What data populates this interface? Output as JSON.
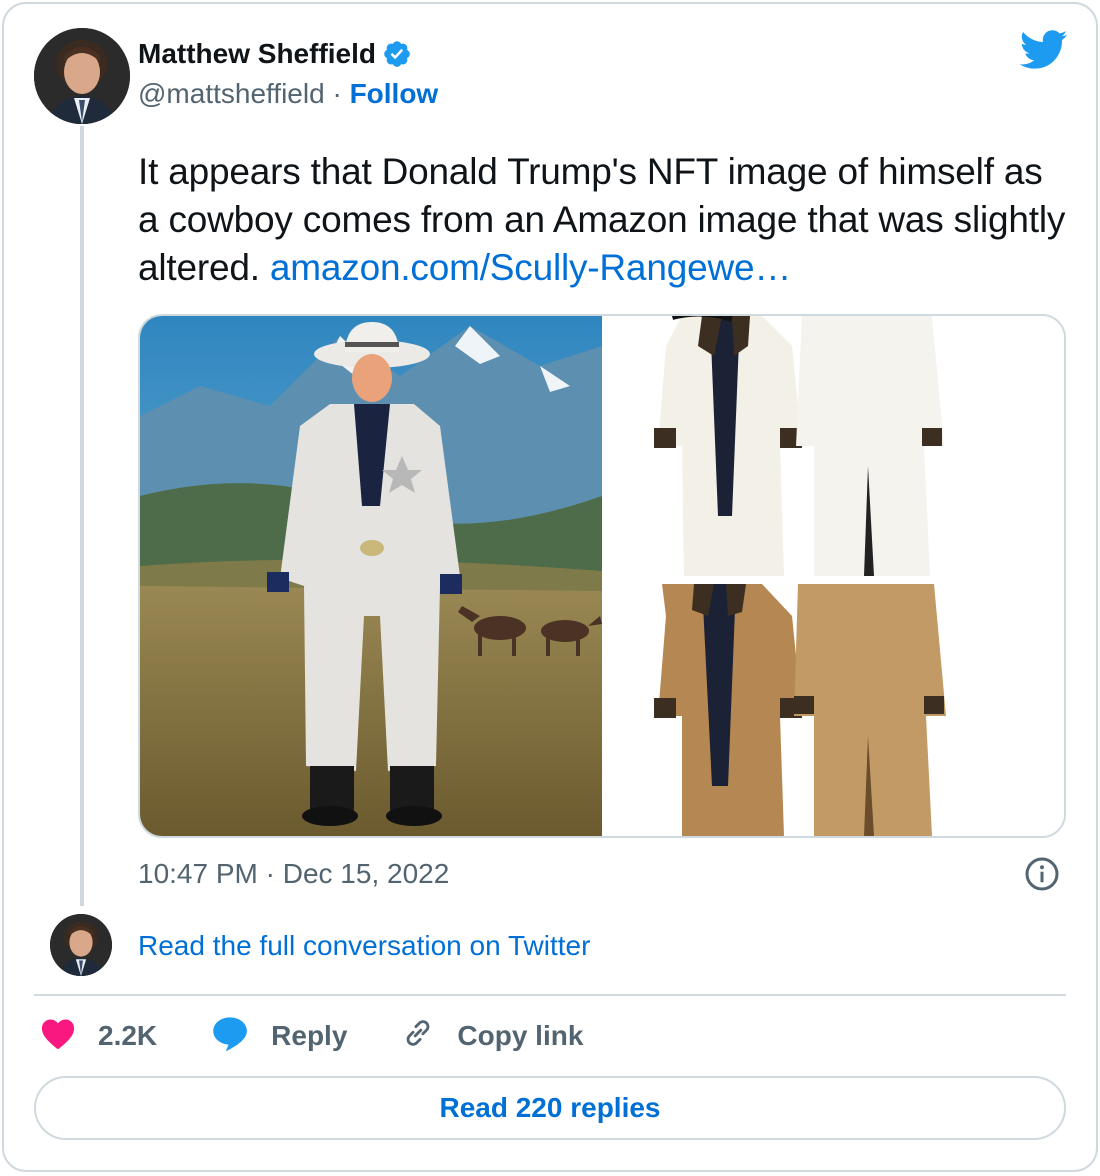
{
  "author": {
    "name": "Matthew Sheffield",
    "handle": "@mattsheffield",
    "separator": "·",
    "follow_label": "Follow",
    "verified": true
  },
  "tweet": {
    "text": "It appears that Donald Trump's NFT image of himself as a cowboy comes from an Amazon image that was slightly altered.",
    "link_text": "amazon.com/Scully-Rangewe…",
    "timestamp": "10:47 PM · Dec 15, 2022"
  },
  "conversation": {
    "read_full_label": "Read the full conversation on Twitter"
  },
  "actions": {
    "likes_count": "2.2K",
    "reply_label": "Reply",
    "copy_link_label": "Copy link"
  },
  "footer": {
    "read_replies_label": "Read 220 replies"
  },
  "icons": {
    "verified": "verified-badge-icon",
    "platform": "twitter-bird-icon",
    "info": "info-icon",
    "like": "heart-icon",
    "reply": "reply-bubble-icon",
    "copy": "link-icon"
  },
  "colors": {
    "link": "#006fd6",
    "twitter_blue": "#1d9bf0",
    "like": "#f91880",
    "muted": "#536471",
    "border": "#cfd9de"
  }
}
